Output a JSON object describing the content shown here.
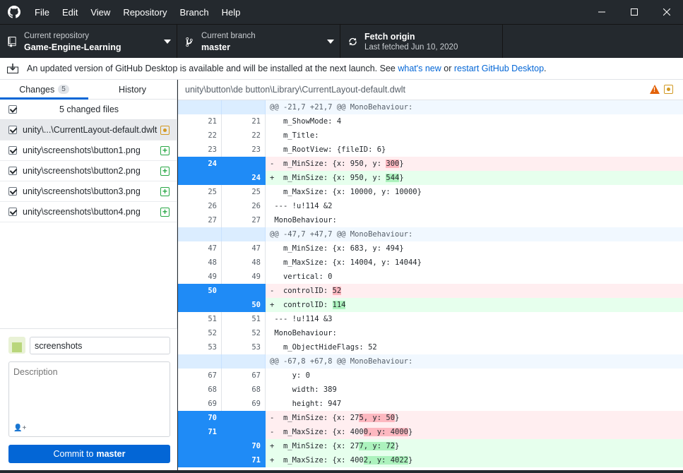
{
  "menu": [
    "File",
    "Edit",
    "View",
    "Repository",
    "Branch",
    "Help"
  ],
  "toolbar": {
    "repo_label": "Current repository",
    "repo_value": "Game-Engine-Learning",
    "branch_label": "Current branch",
    "branch_value": "master",
    "fetch_label": "Fetch origin",
    "fetch_sub": "Last fetched Jun 10, 2020"
  },
  "banner": {
    "text": "An updated version of GitHub Desktop is available and will be installed at the next launch. See",
    "link1": "what's new",
    "or": "or",
    "link2": "restart GitHub Desktop",
    "end": "."
  },
  "tabs": {
    "changes": "Changes",
    "changes_count": "5",
    "history": "History"
  },
  "changes_header": "5 changed files",
  "files": [
    {
      "name": "unity\\...\\CurrentLayout-default.dwlt",
      "status": "modified"
    },
    {
      "name": "unity\\screenshots\\button1.png",
      "status": "added"
    },
    {
      "name": "unity\\screenshots\\button2.png",
      "status": "added"
    },
    {
      "name": "unity\\screenshots\\button3.png",
      "status": "added"
    },
    {
      "name": "unity\\screenshots\\button4.png",
      "status": "added"
    }
  ],
  "commit": {
    "summary": "screenshots",
    "description_placeholder": "Description",
    "button_prefix": "Commit to",
    "button_branch": "master"
  },
  "diff": {
    "path": "unity\\button\\de button\\Library\\CurrentLayout-default.dwlt",
    "lines": [
      {
        "type": "hunk",
        "old": "",
        "new": "",
        "text": "@@ -21,7 +21,7 @@ MonoBehaviour:"
      },
      {
        "type": "ctx",
        "old": "21",
        "new": "21",
        "text": "   m_ShowMode: 4"
      },
      {
        "type": "ctx",
        "old": "22",
        "new": "22",
        "text": "   m_Title:"
      },
      {
        "type": "ctx",
        "old": "23",
        "new": "23",
        "text": "   m_RootView: {fileID: 6}"
      },
      {
        "type": "del",
        "old": "24",
        "new": "",
        "pre": "-  m_MinSize: {x: 950, y: ",
        "hl": "300",
        "post": "}"
      },
      {
        "type": "add",
        "old": "",
        "new": "24",
        "pre": "+  m_MinSize: {x: 950, y: ",
        "hl": "544",
        "post": "}"
      },
      {
        "type": "ctx",
        "old": "25",
        "new": "25",
        "text": "   m_MaxSize: {x: 10000, y: 10000}"
      },
      {
        "type": "ctx",
        "old": "26",
        "new": "26",
        "text": " --- !u!114 &2"
      },
      {
        "type": "ctx",
        "old": "27",
        "new": "27",
        "text": " MonoBehaviour:"
      },
      {
        "type": "hunk",
        "old": "",
        "new": "",
        "text": "@@ -47,7 +47,7 @@ MonoBehaviour:"
      },
      {
        "type": "ctx",
        "old": "47",
        "new": "47",
        "text": "   m_MinSize: {x: 683, y: 494}"
      },
      {
        "type": "ctx",
        "old": "48",
        "new": "48",
        "text": "   m_MaxSize: {x: 14004, y: 14044}"
      },
      {
        "type": "ctx",
        "old": "49",
        "new": "49",
        "text": "   vertical: 0"
      },
      {
        "type": "del",
        "old": "50",
        "new": "",
        "pre": "-  controlID: ",
        "hl": "52",
        "post": ""
      },
      {
        "type": "add",
        "old": "",
        "new": "50",
        "pre": "+  controlID: ",
        "hl": "114",
        "post": ""
      },
      {
        "type": "ctx",
        "old": "51",
        "new": "51",
        "text": " --- !u!114 &3"
      },
      {
        "type": "ctx",
        "old": "52",
        "new": "52",
        "text": " MonoBehaviour:"
      },
      {
        "type": "ctx",
        "old": "53",
        "new": "53",
        "text": "   m_ObjectHideFlags: 52"
      },
      {
        "type": "hunk",
        "old": "",
        "new": "",
        "text": "@@ -67,8 +67,8 @@ MonoBehaviour:"
      },
      {
        "type": "ctx",
        "old": "67",
        "new": "67",
        "text": "     y: 0"
      },
      {
        "type": "ctx",
        "old": "68",
        "new": "68",
        "text": "     width: 389"
      },
      {
        "type": "ctx",
        "old": "69",
        "new": "69",
        "text": "     height: 947"
      },
      {
        "type": "del",
        "old": "70",
        "new": "",
        "pre": "-  m_MinSize: {x: 27",
        "hl": "5, y: 50",
        "post": "}"
      },
      {
        "type": "del",
        "old": "71",
        "new": "",
        "pre": "-  m_MaxSize: {x: 400",
        "hl": "0, y: 4000",
        "post": "}"
      },
      {
        "type": "add",
        "old": "",
        "new": "70",
        "pre": "+  m_MinSize: {x: 27",
        "hl": "7, y: 72",
        "post": "}"
      },
      {
        "type": "add",
        "old": "",
        "new": "71",
        "pre": "+  m_MaxSize: {x: 400",
        "hl": "2, y: 4022",
        "post": "}"
      }
    ]
  }
}
